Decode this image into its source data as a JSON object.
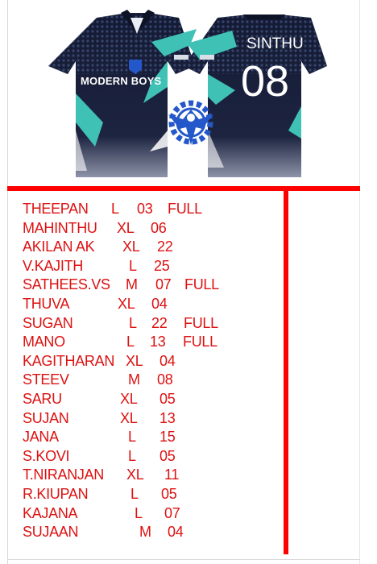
{
  "jersey": {
    "team_text": "MODERN BOYS",
    "back_name": "SINTHU",
    "back_number": "08",
    "colors": {
      "navy": "#141a33",
      "teal": "#3fc1b5",
      "white": "#ffffff",
      "logo_blue": "#2457c9"
    }
  },
  "roster": [
    {
      "name": "THEEPAN",
      "size": "L",
      "number": "03",
      "sleeve": "FULL"
    },
    {
      "name": "MAHINTHU",
      "size": "XL",
      "number": "06",
      "sleeve": ""
    },
    {
      "name": "AKILAN AK",
      "size": "XL",
      "number": "22",
      "sleeve": ""
    },
    {
      "name": "V.KAJITH",
      "size": "L",
      "number": "25",
      "sleeve": ""
    },
    {
      "name": "SATHEES.VS",
      "size": "M",
      "number": "07",
      "sleeve": "FULL"
    },
    {
      "name": "THUVA",
      "size": "XL",
      "number": "04",
      "sleeve": ""
    },
    {
      "name": "SUGAN",
      "size": "L",
      "number": "22",
      "sleeve": "FULL"
    },
    {
      "name": "MANO",
      "size": "L",
      "number": "13",
      "sleeve": "FULL"
    },
    {
      "name": "KAGITHARAN",
      "size": "XL",
      "number": "04",
      "sleeve": ""
    },
    {
      "name": "STEEV",
      "size": "M",
      "number": "08",
      "sleeve": ""
    },
    {
      "name": "SARU",
      "size": "XL",
      "number": "05",
      "sleeve": ""
    },
    {
      "name": "SUJAN",
      "size": "XL",
      "number": "13",
      "sleeve": ""
    },
    {
      "name": "JANA",
      "size": "L",
      "number": "15",
      "sleeve": ""
    },
    {
      "name": "S.KOVI",
      "size": "L",
      "number": "05",
      "sleeve": ""
    },
    {
      "name": "T.NIRANJAN",
      "size": "XL",
      "number": "11",
      "sleeve": ""
    },
    {
      "name": "R.KIUPAN",
      "size": "L",
      "number": "05",
      "sleeve": ""
    },
    {
      "name": "KAJANA",
      "size": "L",
      "number": "07",
      "sleeve": ""
    },
    {
      "name": "SUJAAN",
      "size": "M",
      "number": "04",
      "sleeve": ""
    }
  ]
}
